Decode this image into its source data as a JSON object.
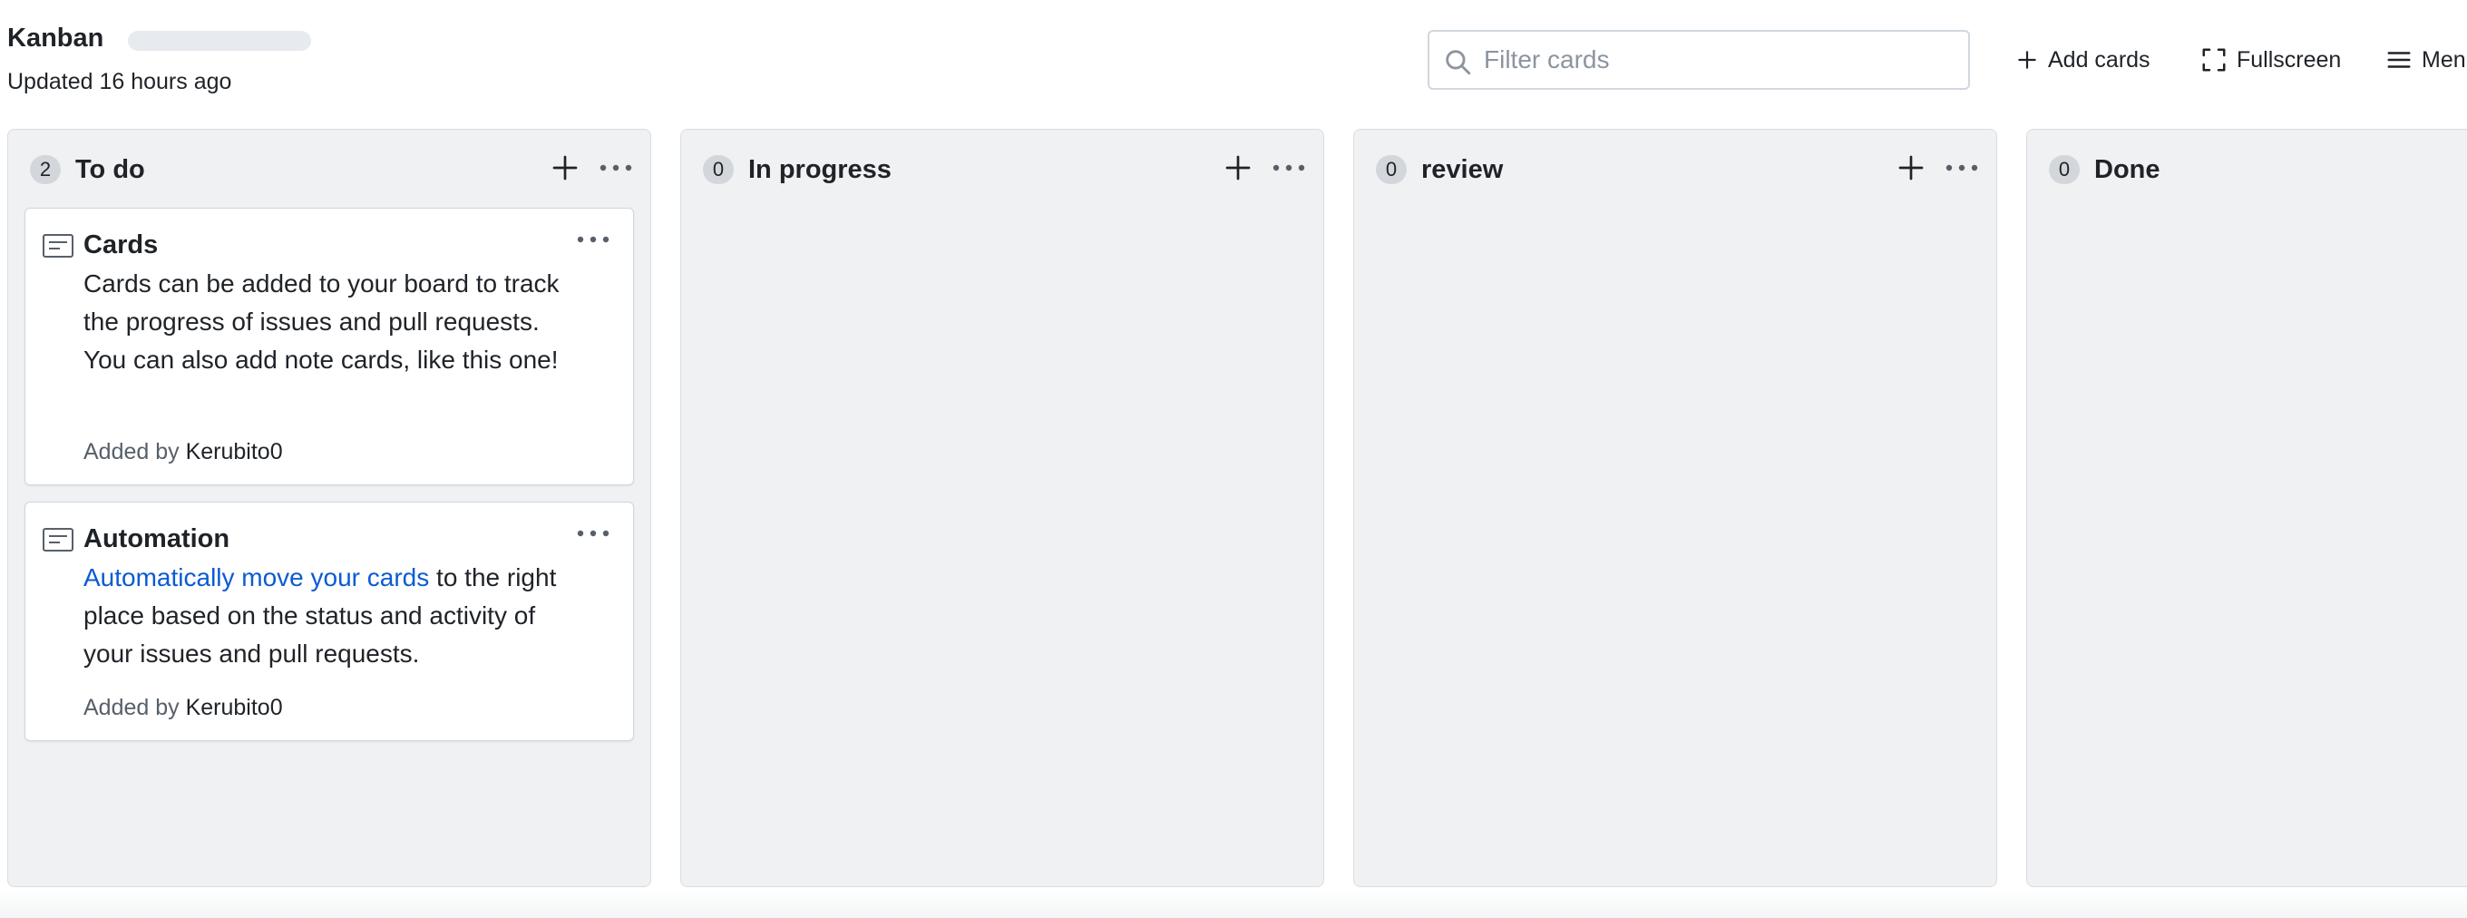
{
  "header": {
    "title": "Kanban",
    "updated": "Updated 16 hours ago",
    "filter_placeholder": "Filter cards",
    "filter_value": "",
    "add_cards": "Add cards",
    "fullscreen": "Fullscreen",
    "menu": "Menu"
  },
  "icons": {
    "search": "search-icon",
    "add": "plus-icon",
    "fullscreen": "fullscreen-icon",
    "menu": "hamburger-icon",
    "more": "kebab-horizontal-icon",
    "note": "note-icon"
  },
  "colors": {
    "column_bg": "#f0f1f3",
    "link": "#0a5bd3",
    "muted_text": "#57606a"
  },
  "columns": [
    {
      "name": "To do",
      "count": "2",
      "cards": [
        {
          "title": "Cards",
          "body": "Cards can be added to your board to track the progress of issues and pull requests. You can also add note cards, like this one!",
          "added_by_label": "Added by",
          "author": "Kerubito0"
        },
        {
          "title": "Automation",
          "link_text": "Automatically move your cards",
          "body": " to the right place based on the status and activity of your issues and pull requests.",
          "added_by_label": "Added by",
          "author": "Kerubito0"
        }
      ]
    },
    {
      "name": "In progress",
      "count": "0",
      "cards": []
    },
    {
      "name": "review",
      "count": "0",
      "cards": []
    },
    {
      "name": "Done",
      "count": "0",
      "cards": []
    }
  ]
}
